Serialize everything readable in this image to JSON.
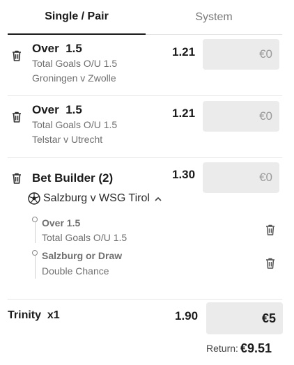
{
  "tabs": [
    {
      "label": "Single / Pair",
      "active": true
    },
    {
      "label": "System",
      "active": false
    }
  ],
  "selections": [
    {
      "title": "Over  1.5",
      "market": "Total Goals O/U 1.5",
      "match": "Groningen v Zwolle",
      "odds": "1.21",
      "stake": "€0"
    },
    {
      "title": "Over  1.5",
      "market": "Total Goals O/U 1.5",
      "match": "Telstar v Utrecht",
      "odds": "1.21",
      "stake": "€0"
    }
  ],
  "bet_builder": {
    "title": "Bet Builder (2)",
    "odds": "1.30",
    "stake": "€0",
    "match": "Salzburg v WSG Tirol",
    "legs": [
      {
        "title": "Over 1.5",
        "market": "Total Goals O/U 1.5"
      },
      {
        "title": "Salzburg or Draw",
        "market": "Double Chance"
      }
    ]
  },
  "footer": {
    "label": "Trinity  x1",
    "odds": "1.90",
    "stake": "€5",
    "return_label": "Return:",
    "return_value": "€9.51"
  },
  "icons": {
    "delete": "trash-icon",
    "sport": "football-icon",
    "collapse": "chevron-up-icon"
  },
  "colors": {
    "text": "#1b1b1b",
    "muted": "#6f6f6f",
    "stake_bg": "#ebebeb"
  }
}
